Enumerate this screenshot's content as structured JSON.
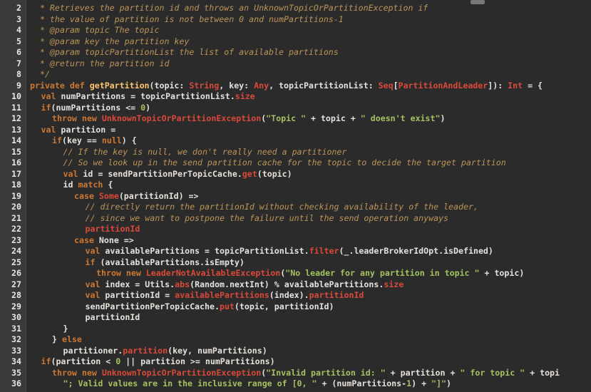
{
  "editor": {
    "lines": [
      {
        "n": "2",
        "indent": 0,
        "tokens": [
          {
            "t": "cm",
            "v": "  * Retrieves the partition id and throws an UnknownTopicOrPartitionException if"
          }
        ]
      },
      {
        "n": "3",
        "indent": 0,
        "tokens": [
          {
            "t": "cm",
            "v": "  * the value of partition is not between 0 and numPartitions-1"
          }
        ]
      },
      {
        "n": "4",
        "indent": 0,
        "tokens": [
          {
            "t": "cm",
            "v": "  * @param topic The topic"
          }
        ]
      },
      {
        "n": "5",
        "indent": 0,
        "tokens": [
          {
            "t": "cm",
            "v": "  * @param key the partition key"
          }
        ]
      },
      {
        "n": "6",
        "indent": 0,
        "tokens": [
          {
            "t": "cm",
            "v": "  * @param topicPartitionList the list of available partitions"
          }
        ]
      },
      {
        "n": "7",
        "indent": 0,
        "tokens": [
          {
            "t": "cm",
            "v": "  * @return the partition id"
          }
        ]
      },
      {
        "n": "8",
        "indent": 0,
        "tokens": [
          {
            "t": "cm",
            "v": "  */"
          }
        ]
      },
      {
        "n": "9",
        "indent": 0,
        "tokens": [
          {
            "t": "kw",
            "v": "private def "
          },
          {
            "t": "fn",
            "v": "getPartition"
          },
          {
            "t": "pl",
            "v": "(topic: "
          },
          {
            "t": "ty",
            "v": "String"
          },
          {
            "t": "pl",
            "v": ", key: "
          },
          {
            "t": "ty",
            "v": "Any"
          },
          {
            "t": "pl",
            "v": ", topicPartitionList: "
          },
          {
            "t": "ty",
            "v": "Seq"
          },
          {
            "t": "pl",
            "v": "["
          },
          {
            "t": "ty",
            "v": "PartitionAndLeader"
          },
          {
            "t": "pl",
            "v": "]): "
          },
          {
            "t": "ty",
            "v": "Int"
          },
          {
            "t": "pl",
            "v": " = {"
          }
        ]
      },
      {
        "n": "10",
        "indent": 1,
        "tokens": [
          {
            "t": "kw",
            "v": "val "
          },
          {
            "t": "pl",
            "v": "numPartitions = topicPartitionList."
          },
          {
            "t": "cls",
            "v": "size"
          }
        ]
      },
      {
        "n": "11",
        "indent": 1,
        "tokens": [
          {
            "t": "kw",
            "v": "if"
          },
          {
            "t": "pl",
            "v": "(numPartitions <= "
          },
          {
            "t": "num",
            "v": "0"
          },
          {
            "t": "pl",
            "v": ")"
          }
        ]
      },
      {
        "n": "12",
        "indent": 2,
        "tokens": [
          {
            "t": "kw",
            "v": "throw new "
          },
          {
            "t": "cls",
            "v": "UnknownTopicOrPartitionException"
          },
          {
            "t": "pl",
            "v": "("
          },
          {
            "t": "str",
            "v": "\"Topic \""
          },
          {
            "t": "pl",
            "v": " + topic + "
          },
          {
            "t": "str",
            "v": "\" doesn't exist\""
          },
          {
            "t": "pl",
            "v": ")"
          }
        ]
      },
      {
        "n": "13",
        "indent": 1,
        "tokens": [
          {
            "t": "kw",
            "v": "val "
          },
          {
            "t": "pl",
            "v": "partition ="
          }
        ]
      },
      {
        "n": "14",
        "indent": 2,
        "tokens": [
          {
            "t": "kw",
            "v": "if"
          },
          {
            "t": "pl",
            "v": "(key == "
          },
          {
            "t": "kw",
            "v": "null"
          },
          {
            "t": "pl",
            "v": ") {"
          }
        ]
      },
      {
        "n": "15",
        "indent": 3,
        "tokens": [
          {
            "t": "cm",
            "v": "// If the key is null, we don't really need a partitioner"
          }
        ]
      },
      {
        "n": "16",
        "indent": 3,
        "tokens": [
          {
            "t": "cm",
            "v": "// So we look up in the send partition cache for the topic to decide the target partition"
          }
        ]
      },
      {
        "n": "17",
        "indent": 3,
        "tokens": [
          {
            "t": "kw",
            "v": "val "
          },
          {
            "t": "pl",
            "v": "id = sendPartitionPerTopicCache."
          },
          {
            "t": "cls",
            "v": "get"
          },
          {
            "t": "pl",
            "v": "(topic)"
          }
        ]
      },
      {
        "n": "18",
        "indent": 3,
        "tokens": [
          {
            "t": "pl",
            "v": "id "
          },
          {
            "t": "kw",
            "v": "match"
          },
          {
            "t": "pl",
            "v": " {"
          }
        ]
      },
      {
        "n": "19",
        "indent": 4,
        "tokens": [
          {
            "t": "kw",
            "v": "case "
          },
          {
            "t": "cls",
            "v": "Some"
          },
          {
            "t": "pl",
            "v": "(partitionId) =>"
          }
        ]
      },
      {
        "n": "20",
        "indent": 5,
        "tokens": [
          {
            "t": "cm",
            "v": "// directly return the partitionId without checking availability of the leader,"
          }
        ]
      },
      {
        "n": "21",
        "indent": 5,
        "tokens": [
          {
            "t": "cm",
            "v": "// since we want to postpone the failure until the send operation anyways"
          }
        ]
      },
      {
        "n": "22",
        "indent": 5,
        "tokens": [
          {
            "t": "cls",
            "v": "partitionId"
          }
        ]
      },
      {
        "n": "23",
        "indent": 4,
        "tokens": [
          {
            "t": "kw",
            "v": "case "
          },
          {
            "t": "pl",
            "v": "None =>"
          }
        ]
      },
      {
        "n": "24",
        "indent": 5,
        "tokens": [
          {
            "t": "kw",
            "v": "val "
          },
          {
            "t": "pl",
            "v": "availablePartitions = topicPartitionList."
          },
          {
            "t": "cls",
            "v": "filter"
          },
          {
            "t": "pl",
            "v": "(_.leaderBrokerIdOpt.isDefined)"
          }
        ]
      },
      {
        "n": "25",
        "indent": 5,
        "tokens": [
          {
            "t": "kw",
            "v": "if "
          },
          {
            "t": "pl",
            "v": "(availablePartitions.isEmpty)"
          }
        ]
      },
      {
        "n": "26",
        "indent": 6,
        "tokens": [
          {
            "t": "kw",
            "v": "throw new "
          },
          {
            "t": "cls",
            "v": "LeaderNotAvailableException"
          },
          {
            "t": "pl",
            "v": "("
          },
          {
            "t": "str",
            "v": "\"No leader for any partition in topic \""
          },
          {
            "t": "pl",
            "v": " + topic)"
          }
        ]
      },
      {
        "n": "27",
        "indent": 5,
        "tokens": [
          {
            "t": "kw",
            "v": "val "
          },
          {
            "t": "pl",
            "v": "index = Utils."
          },
          {
            "t": "cls",
            "v": "abs"
          },
          {
            "t": "pl",
            "v": "(Random.nextInt) % availablePartitions."
          },
          {
            "t": "cls",
            "v": "size"
          }
        ]
      },
      {
        "n": "28",
        "indent": 5,
        "tokens": [
          {
            "t": "kw",
            "v": "val "
          },
          {
            "t": "pl",
            "v": "partitionId = "
          },
          {
            "t": "cls",
            "v": "availablePartitions"
          },
          {
            "t": "pl",
            "v": "(index)."
          },
          {
            "t": "cls",
            "v": "partitionId"
          }
        ]
      },
      {
        "n": "29",
        "indent": 5,
        "tokens": [
          {
            "t": "pl",
            "v": "sendPartitionPerTopicCache."
          },
          {
            "t": "cls",
            "v": "put"
          },
          {
            "t": "pl",
            "v": "(topic, partitionId)"
          }
        ]
      },
      {
        "n": "30",
        "indent": 5,
        "tokens": [
          {
            "t": "pl",
            "v": "partitionId"
          }
        ]
      },
      {
        "n": "31",
        "indent": 3,
        "tokens": [
          {
            "t": "pl",
            "v": "}"
          }
        ]
      },
      {
        "n": "32",
        "indent": 2,
        "tokens": [
          {
            "t": "pl",
            "v": "} "
          },
          {
            "t": "kw",
            "v": "else"
          }
        ]
      },
      {
        "n": "33",
        "indent": 3,
        "tokens": [
          {
            "t": "pl",
            "v": "partitioner."
          },
          {
            "t": "cls",
            "v": "partition"
          },
          {
            "t": "pl",
            "v": "(key, numPartitions)"
          }
        ]
      },
      {
        "n": "34",
        "indent": 1,
        "tokens": [
          {
            "t": "kw",
            "v": "if"
          },
          {
            "t": "pl",
            "v": "(partition < "
          },
          {
            "t": "num",
            "v": "0"
          },
          {
            "t": "pl",
            "v": " || partition >= numPartitions)"
          }
        ]
      },
      {
        "n": "35",
        "indent": 2,
        "tokens": [
          {
            "t": "kw",
            "v": "throw new "
          },
          {
            "t": "cls",
            "v": "UnknownTopicOrPartitionException"
          },
          {
            "t": "pl",
            "v": "("
          },
          {
            "t": "str",
            "v": "\"Invalid partition id: \""
          },
          {
            "t": "pl",
            "v": " + partition + "
          },
          {
            "t": "str",
            "v": "\" for topic \""
          },
          {
            "t": "pl",
            "v": " + topi"
          }
        ]
      },
      {
        "n": "36",
        "indent": 3,
        "tokens": [
          {
            "t": "str",
            "v": "\"; Valid values are in the inclusive range of [0, \""
          },
          {
            "t": "pl",
            "v": " + (numPartitions-"
          },
          {
            "t": "num",
            "v": "1"
          },
          {
            "t": "pl",
            "v": ") + "
          },
          {
            "t": "str",
            "v": "\"]\""
          },
          {
            "t": "pl",
            "v": ")"
          }
        ]
      }
    ]
  },
  "colors": {
    "background": "#2b2b2b",
    "gutter": "#3a3a3a",
    "keyword": "#cc7833",
    "comment": "#bc9458",
    "string": "#a5c261",
    "type": "#da4939"
  }
}
